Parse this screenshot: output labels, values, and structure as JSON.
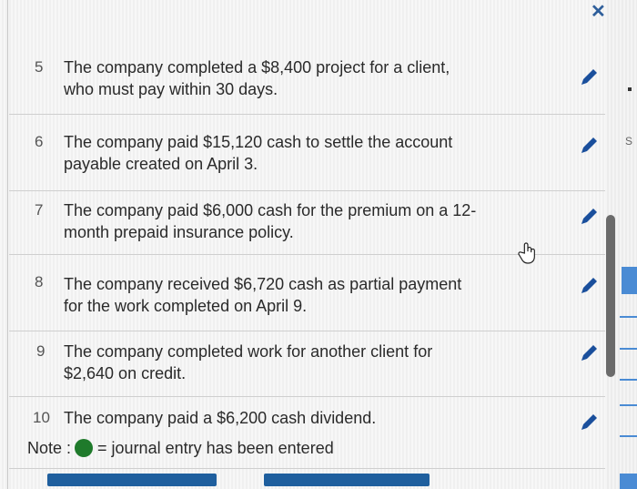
{
  "items": [
    {
      "number": "5",
      "line1": "The company completed a $8,400 project for a client,",
      "line2": "who must pay within 30 days."
    },
    {
      "number": "6",
      "line1": "The company paid $15,120 cash to settle the account",
      "line2": "payable created on April 3."
    },
    {
      "number": "7",
      "line1": "The company paid $6,000 cash for the premium on a 12-",
      "line2": "month prepaid insurance policy."
    },
    {
      "number": "8",
      "line1": "The company received $6,720 cash as partial payment",
      "line2": "for the work completed on April 9."
    },
    {
      "number": "9",
      "line1": "The company completed work for another client for",
      "line2": "$2,640 on credit."
    },
    {
      "number": "10",
      "line1": "The company paid a $6,200 cash dividend."
    }
  ],
  "note": {
    "label": "Note :",
    "text": "= journal entry has been entered",
    "dot_color": "#1f7a2b"
  },
  "icons": {
    "edit": "pencil-icon",
    "close": "close-icon",
    "cursor": "hand-cursor-icon"
  },
  "colors": {
    "pencil": "#1a4f9c",
    "button": "#1f5f9e"
  },
  "edge_text": "S"
}
